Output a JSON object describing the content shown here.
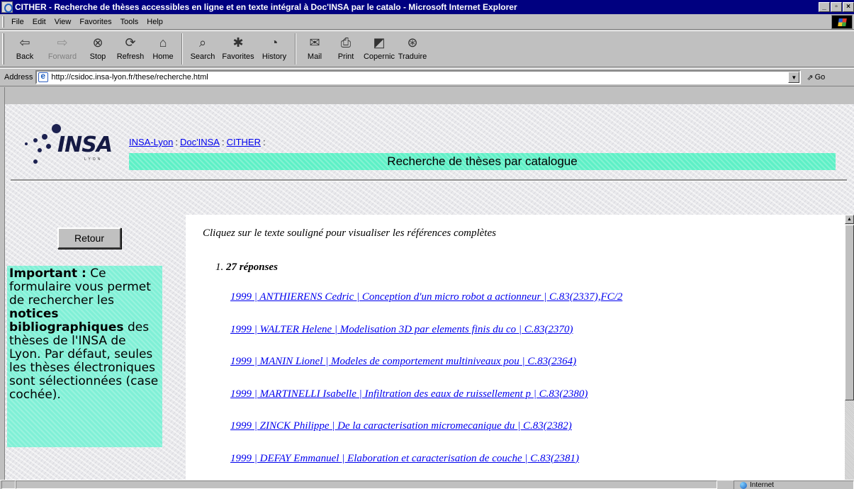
{
  "window": {
    "title": "CITHER - Recherche de thèses accessibles en ligne et en texte intégral à Doc'INSA par le catalo - Microsoft Internet Explorer"
  },
  "menu": [
    "File",
    "Edit",
    "View",
    "Favorites",
    "Tools",
    "Help"
  ],
  "toolbar": [
    {
      "label": "Back",
      "icon": "back-arrow-icon",
      "glyph": "⇦",
      "enabled": true
    },
    {
      "label": "Forward",
      "icon": "forward-arrow-icon",
      "glyph": "⇨",
      "enabled": false
    },
    {
      "label": "Stop",
      "icon": "stop-icon",
      "glyph": "⊗",
      "enabled": true
    },
    {
      "label": "Refresh",
      "icon": "refresh-icon",
      "glyph": "⟳",
      "enabled": true
    },
    {
      "label": "Home",
      "icon": "home-icon",
      "glyph": "⌂",
      "enabled": true
    },
    {
      "label": "Search",
      "icon": "search-icon",
      "glyph": "⌕",
      "enabled": true
    },
    {
      "label": "Favorites",
      "icon": "favorites-icon",
      "glyph": "✱",
      "enabled": true
    },
    {
      "label": "History",
      "icon": "history-icon",
      "glyph": "◔",
      "enabled": true
    },
    {
      "label": "Mail",
      "icon": "mail-icon",
      "glyph": "✉",
      "enabled": true
    },
    {
      "label": "Print",
      "icon": "print-icon",
      "glyph": "⎙",
      "enabled": true
    },
    {
      "label": "Copernic",
      "icon": "copernic-icon",
      "glyph": "◩",
      "enabled": true
    },
    {
      "label": "Traduire",
      "icon": "translate-icon",
      "glyph": "⊛",
      "enabled": true
    }
  ],
  "address": {
    "label": "Address",
    "url": "http://csidoc.insa-lyon.fr/these/recherche.html",
    "go": "Go"
  },
  "page": {
    "logo": {
      "word": "INSA",
      "sub": "LYON"
    },
    "breadcrumbs": [
      "INSA-Lyon",
      "Doc'INSA",
      "CITHER"
    ],
    "banner": "Recherche de thèses par catalogue",
    "retour": "Retour",
    "important_label": "Important :",
    "important_text_1": " Ce formulaire vous permet de rechercher les ",
    "important_bold": "notices bibliographiques",
    "important_text_2": " des thèses de l'INSA de Lyon. Par défaut, seules les thèses électroniques sont sélectionnées (case cochée).",
    "intro": "Cliquez sur le texte souligné pour visualiser les références complètes",
    "list_number": "1.",
    "count": "27 réponses",
    "results": [
      "1999 | ANTHIERENS Cedric | Conception d'un micro robot a actionneur | C.83(2337),FC/2",
      "1999 | WALTER Helene | Modelisation 3D par elements finis du co | C.83(2370)",
      "1999 | MANIN Lionel | Modeles de comportement multiniveaux pou | C.83(2364)",
      "1999 | MARTINELLI Isabelle | Infiltration des eaux de ruissellement p | C.83(2380)",
      "1999 | ZINCK Philippe | De la caracterisation micromecanique du | C.83(2382)",
      "1999 | DEFAY Emmanuel | Elaboration et caracterisation de couche | C.83(2381)"
    ]
  },
  "status": {
    "zone": "Internet"
  }
}
